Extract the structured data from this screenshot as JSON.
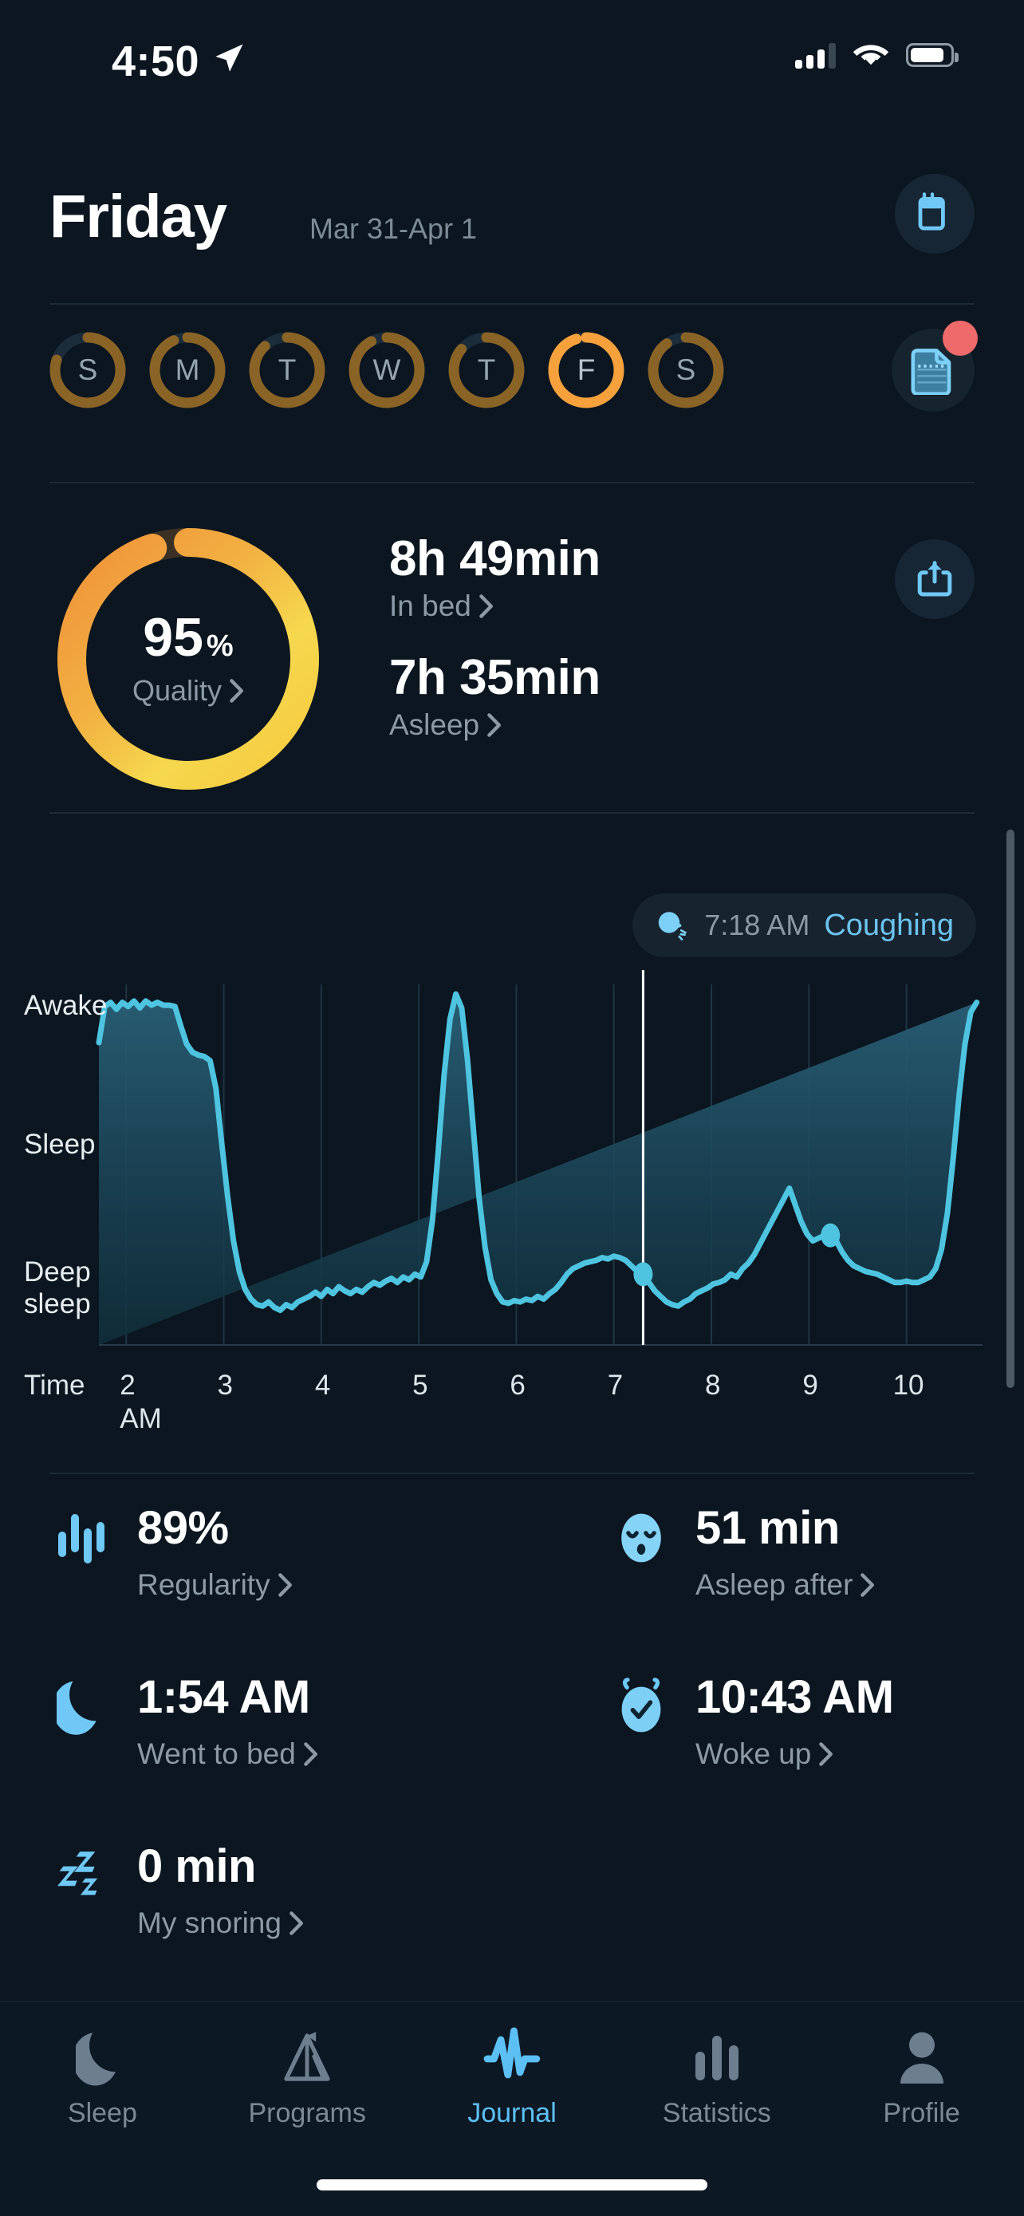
{
  "status_bar": {
    "time": "4:50",
    "location_icon": "location-arrow-icon",
    "signal_icon": "cellular-signal-icon",
    "wifi_icon": "wifi-icon",
    "battery_icon": "battery-icon"
  },
  "header": {
    "day": "Friday",
    "date_range": "Mar 31-Apr 1",
    "calendar_icon": "calendar-icon"
  },
  "weekdays": [
    {
      "label": "S",
      "selected": false,
      "progress": 0.8
    },
    {
      "label": "M",
      "selected": false,
      "progress": 0.93
    },
    {
      "label": "T",
      "selected": false,
      "progress": 0.88
    },
    {
      "label": "W",
      "selected": false,
      "progress": 0.92
    },
    {
      "label": "T",
      "selected": false,
      "progress": 0.86
    },
    {
      "label": "F",
      "selected": true,
      "progress": 0.95
    },
    {
      "label": "S",
      "selected": false,
      "progress": 0.9
    }
  ],
  "journal_button": {
    "icon": "journal-note-icon",
    "has_badge": true,
    "badge_color": "#ef6a6a"
  },
  "summary": {
    "quality_value": "95",
    "quality_unit": "%",
    "quality_label": "Quality",
    "in_bed_value": "8h 49min",
    "in_bed_label": "In bed",
    "asleep_value": "7h 35min",
    "asleep_label": "Asleep",
    "share_icon": "share-icon",
    "ring_start_color": "#f6d84e",
    "ring_end_color": "#f0903a",
    "ring_track_color": "#3a3024",
    "ring_progress": 0.95
  },
  "chart_annotation": {
    "icon": "coughing-head-icon",
    "time": "7:18 AM",
    "label": "Coughing"
  },
  "chart_data": {
    "type": "area",
    "title": "",
    "xlabel": "Time",
    "ylabel": "",
    "y_tick_labels": [
      "Awake",
      "Sleep",
      "Deep sleep"
    ],
    "y_tick_values": [
      3,
      2,
      1
    ],
    "ylim": [
      0.55,
      3.15
    ],
    "x_tick_labels": [
      "2",
      "3",
      "4",
      "5",
      "6",
      "7",
      "8",
      "9",
      "10"
    ],
    "x_am_label": "AM",
    "xlim": [
      1.72,
      10.78
    ],
    "grid": true,
    "line_color": "#4ec4e0",
    "fill_top_color": "#23576a",
    "fill_bottom_color": "#10323f",
    "marker_line_x": 7.3,
    "marker_line_color": "#ffffff",
    "markers": [
      {
        "x": 7.3,
        "y": 1.06,
        "label": "Coughing"
      },
      {
        "x": 9.22,
        "y": 1.34,
        "label": "event"
      }
    ],
    "x": [
      1.72,
      1.78,
      1.84,
      1.9,
      1.96,
      2.02,
      2.08,
      2.14,
      2.2,
      2.26,
      2.32,
      2.38,
      2.44,
      2.5,
      2.56,
      2.62,
      2.68,
      2.74,
      2.8,
      2.86,
      2.92,
      2.98,
      3.04,
      3.1,
      3.16,
      3.22,
      3.28,
      3.34,
      3.4,
      3.46,
      3.52,
      3.58,
      3.64,
      3.7,
      3.76,
      3.82,
      3.88,
      3.94,
      4.0,
      4.06,
      4.12,
      4.18,
      4.24,
      4.3,
      4.36,
      4.42,
      4.48,
      4.54,
      4.6,
      4.66,
      4.72,
      4.78,
      4.84,
      4.9,
      4.96,
      5.02,
      5.08,
      5.14,
      5.2,
      5.26,
      5.32,
      5.38,
      5.44,
      5.5,
      5.56,
      5.62,
      5.68,
      5.74,
      5.8,
      5.86,
      5.92,
      5.98,
      6.04,
      6.1,
      6.16,
      6.22,
      6.28,
      6.34,
      6.4,
      6.46,
      6.52,
      6.58,
      6.64,
      6.7,
      6.76,
      6.82,
      6.88,
      6.94,
      7.0,
      7.06,
      7.12,
      7.18,
      7.24,
      7.3,
      7.36,
      7.42,
      7.48,
      7.54,
      7.6,
      7.66,
      7.72,
      7.78,
      7.84,
      7.9,
      7.96,
      8.02,
      8.08,
      8.14,
      8.2,
      8.26,
      8.32,
      8.38,
      8.44,
      8.5,
      8.56,
      8.62,
      8.68,
      8.74,
      8.8,
      8.86,
      8.92,
      8.98,
      9.04,
      9.1,
      9.16,
      9.22,
      9.28,
      9.34,
      9.4,
      9.46,
      9.52,
      9.58,
      9.64,
      9.7,
      9.76,
      9.82,
      9.88,
      9.94,
      10.0,
      10.06,
      10.12,
      10.18,
      10.24,
      10.3,
      10.36,
      10.42,
      10.48,
      10.54,
      10.6,
      10.66,
      10.72,
      10.78
    ],
    "y": [
      2.73,
      2.99,
      3.02,
      2.97,
      3.02,
      2.99,
      3.03,
      2.98,
      3.03,
      3.0,
      3.02,
      3.0,
      3.0,
      2.99,
      2.85,
      2.72,
      2.66,
      2.64,
      2.63,
      2.6,
      2.4,
      2.0,
      1.62,
      1.3,
      1.08,
      0.95,
      0.88,
      0.84,
      0.83,
      0.86,
      0.82,
      0.8,
      0.84,
      0.82,
      0.86,
      0.88,
      0.9,
      0.93,
      0.9,
      0.95,
      0.92,
      0.97,
      0.94,
      0.92,
      0.95,
      0.93,
      0.97,
      1.0,
      0.98,
      1.01,
      1.03,
      1.0,
      1.04,
      1.02,
      1.06,
      1.04,
      1.15,
      1.45,
      1.95,
      2.5,
      2.9,
      3.08,
      2.98,
      2.6,
      2.1,
      1.6,
      1.25,
      1.02,
      0.92,
      0.86,
      0.85,
      0.87,
      0.86,
      0.88,
      0.87,
      0.9,
      0.88,
      0.92,
      0.95,
      1.0,
      1.06,
      1.1,
      1.12,
      1.14,
      1.15,
      1.16,
      1.18,
      1.17,
      1.19,
      1.18,
      1.16,
      1.12,
      1.08,
      1.06,
      1.0,
      0.94,
      0.9,
      0.86,
      0.84,
      0.83,
      0.86,
      0.88,
      0.92,
      0.94,
      0.96,
      0.99,
      1.0,
      1.02,
      1.06,
      1.04,
      1.1,
      1.14,
      1.2,
      1.28,
      1.36,
      1.44,
      1.52,
      1.6,
      1.68,
      1.56,
      1.44,
      1.35,
      1.3,
      1.32,
      1.34,
      1.36,
      1.3,
      1.22,
      1.16,
      1.12,
      1.1,
      1.08,
      1.07,
      1.06,
      1.04,
      1.02,
      1.0,
      1.0,
      1.01,
      1.0,
      1.0,
      1.02,
      1.04,
      1.1,
      1.24,
      1.5,
      1.9,
      2.35,
      2.72,
      2.95,
      3.02
    ]
  },
  "stats": [
    [
      {
        "icon": "regularity-bars-icon",
        "value": "89%",
        "label": "Regularity"
      },
      {
        "icon": "sleeping-face-icon",
        "value": "51 min",
        "label": "Asleep after"
      }
    ],
    [
      {
        "icon": "moon-icon",
        "value": "1:54 AM",
        "label": "Went to bed"
      },
      {
        "icon": "alarm-clock-icon",
        "value": "10:43 AM",
        "label": "Woke up"
      }
    ],
    [
      {
        "icon": "zzz-snoring-icon",
        "value": "0 min",
        "label": "My snoring"
      }
    ]
  ],
  "tabs": [
    {
      "icon": "moon-icon",
      "label": "Sleep",
      "active": false
    },
    {
      "icon": "programs-tent-icon",
      "label": "Programs",
      "active": false
    },
    {
      "icon": "journal-waveform-icon",
      "label": "Journal",
      "active": true
    },
    {
      "icon": "statistics-bars-icon",
      "label": "Statistics",
      "active": false
    },
    {
      "icon": "profile-person-icon",
      "label": "Profile",
      "active": false
    }
  ]
}
